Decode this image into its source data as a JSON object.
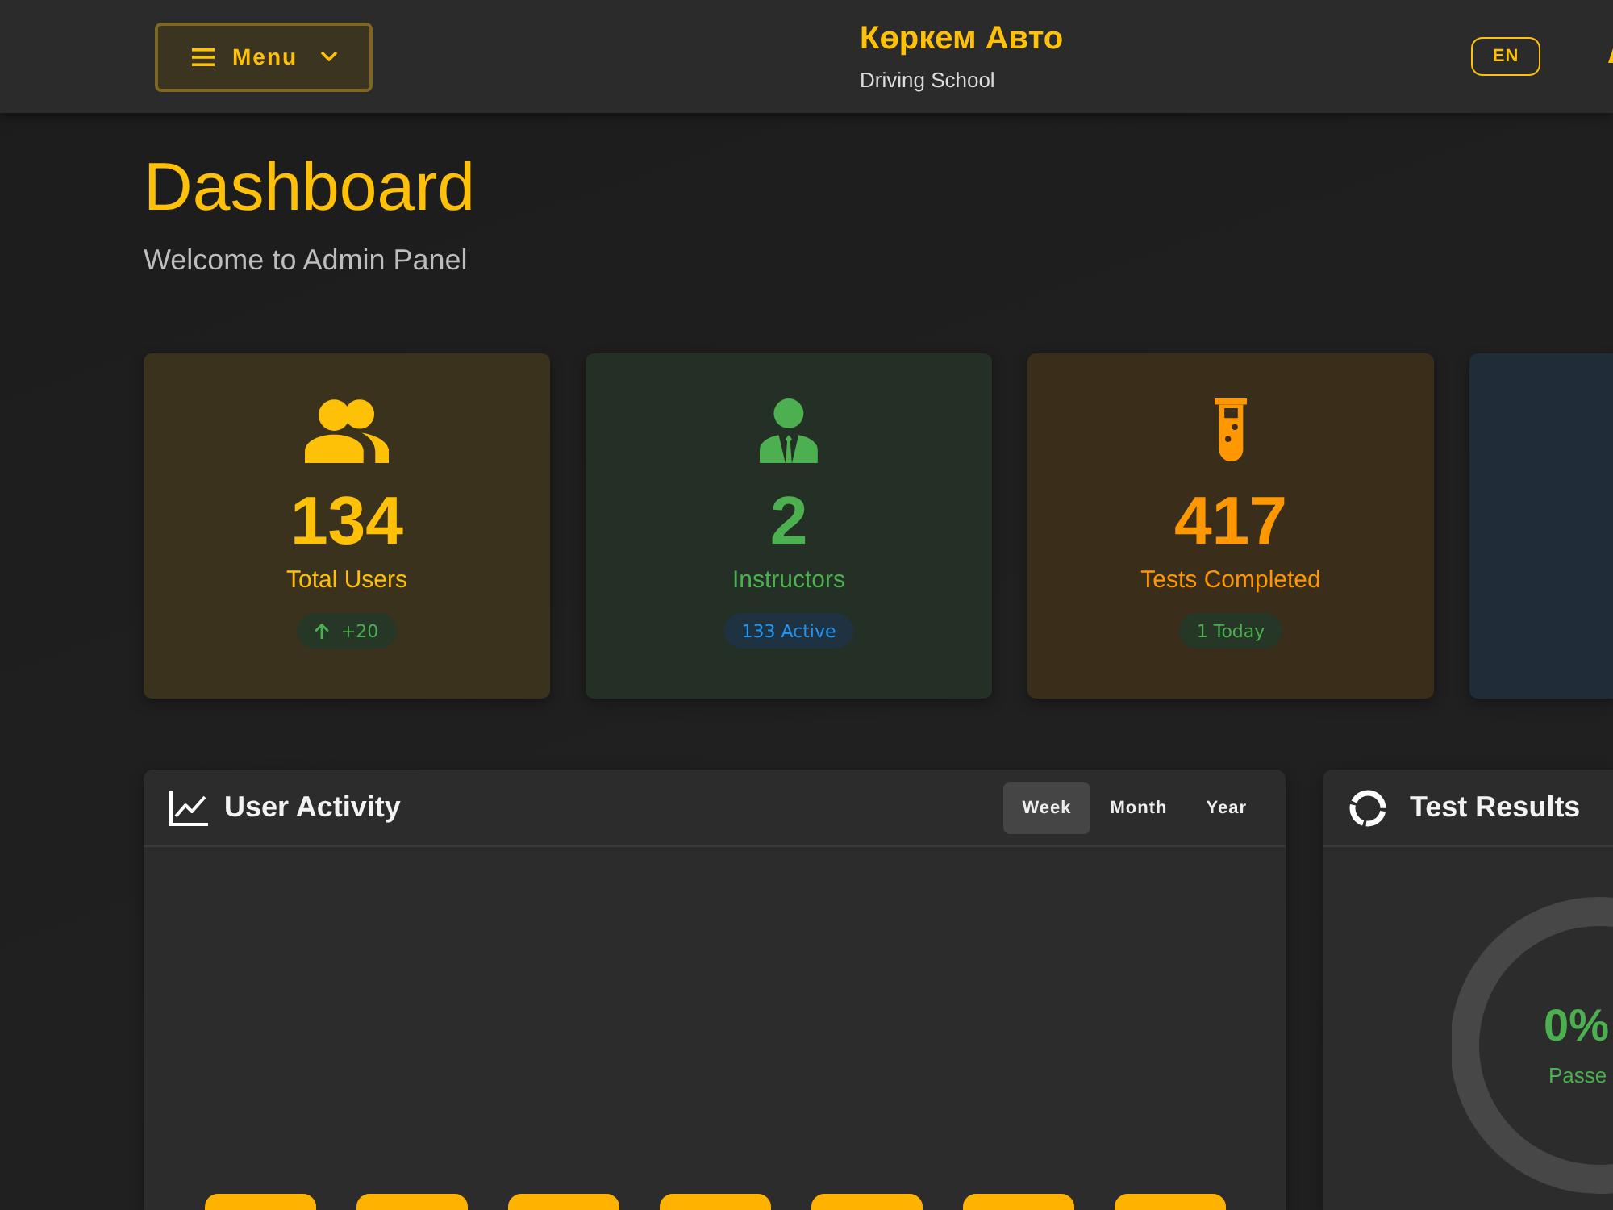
{
  "header": {
    "menu_button": {
      "label": "Menu"
    },
    "brand": {
      "title": "Көркем Авто",
      "subtitle": "Driving School"
    },
    "language_button": {
      "label": "EN"
    }
  },
  "page": {
    "title": "Dashboard",
    "subtitle": "Welcome to Admin Panel"
  },
  "stats": [
    {
      "value": "134",
      "label": "Total Users",
      "color": "#ffc107",
      "badge": {
        "kind": "trend",
        "text": "+20",
        "color": "#4caf50"
      }
    },
    {
      "value": "2",
      "label": "Instructors",
      "color": "#4caf50",
      "badge": {
        "kind": "plain",
        "text": "133 Active",
        "color": "#2196f3"
      }
    },
    {
      "value": "417",
      "label": "Tests Completed",
      "color": "#ff9800",
      "badge": {
        "kind": "plain",
        "text": "1 Today",
        "color": "#4caf50"
      }
    },
    {
      "color": "#202c38"
    }
  ],
  "user_activity": {
    "title": "User Activity",
    "tabs": [
      {
        "label": "Week",
        "selected": true
      },
      {
        "label": "Month",
        "selected": false
      },
      {
        "label": "Year",
        "selected": false
      }
    ]
  },
  "test_results": {
    "title": "Test Results",
    "center_value": "0%",
    "center_label": "Passe"
  }
}
